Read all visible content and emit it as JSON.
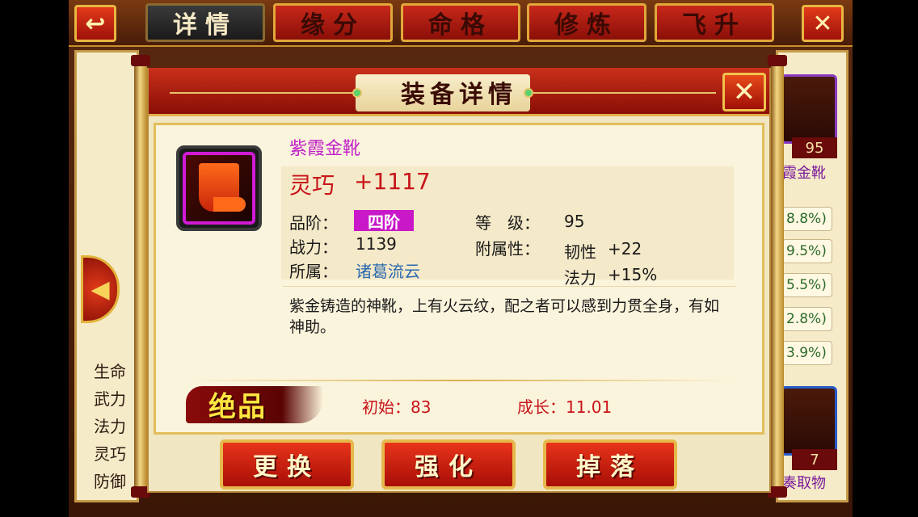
{
  "nav": {
    "back_icon": "back-arrow-icon",
    "close_icon": "close-x-icon",
    "tabs": [
      {
        "label": "详情",
        "active": true
      },
      {
        "label": "缘分",
        "active": false
      },
      {
        "label": "命格",
        "active": false
      },
      {
        "label": "修炼",
        "active": false
      },
      {
        "label": "飞升",
        "active": false
      }
    ]
  },
  "background": {
    "left_stats": [
      "生命",
      "武力",
      "法力",
      "灵巧",
      "防御"
    ],
    "right_percents": [
      "8.8%)",
      "9.5%)",
      "5.5%)",
      "2.8%)",
      "3.9%)"
    ],
    "right_item_top": {
      "level": "95",
      "name": "霞金靴"
    },
    "right_item_bottom": {
      "level": "7",
      "name": "奏取物"
    }
  },
  "dialog": {
    "title": "装备详情",
    "item": {
      "name": "紫霞金靴",
      "main_attr_label": "灵巧",
      "main_attr_value": "+1117",
      "grade_label": "品阶：",
      "grade_value": "四阶",
      "power_label": "战力：",
      "power_value": "1139",
      "owner_label": "所属：",
      "owner_value": "诸葛流云",
      "level_label": "等　级：",
      "level_value": "95",
      "sub_attr_label": "附属性：",
      "sub_attrs": [
        {
          "name": "韧性",
          "value": "+22"
        },
        {
          "name": "法力",
          "value": "+15%"
        }
      ],
      "description": "紫金铸造的神靴，上有火云纹，配之者可以感到力贯全身，有如神助。",
      "quality": "绝品",
      "initial": "初始：83",
      "growth": "成长：11.01"
    },
    "buttons": {
      "replace": "更换",
      "strengthen": "强化",
      "drop": "掉落"
    },
    "colors": {
      "name_purple": "#c020c8",
      "attr_red": "#c8141a",
      "grade_badge": "#c818c8",
      "owner_blue": "#2a6ab0",
      "quality_yellow": "#ffe640"
    }
  }
}
